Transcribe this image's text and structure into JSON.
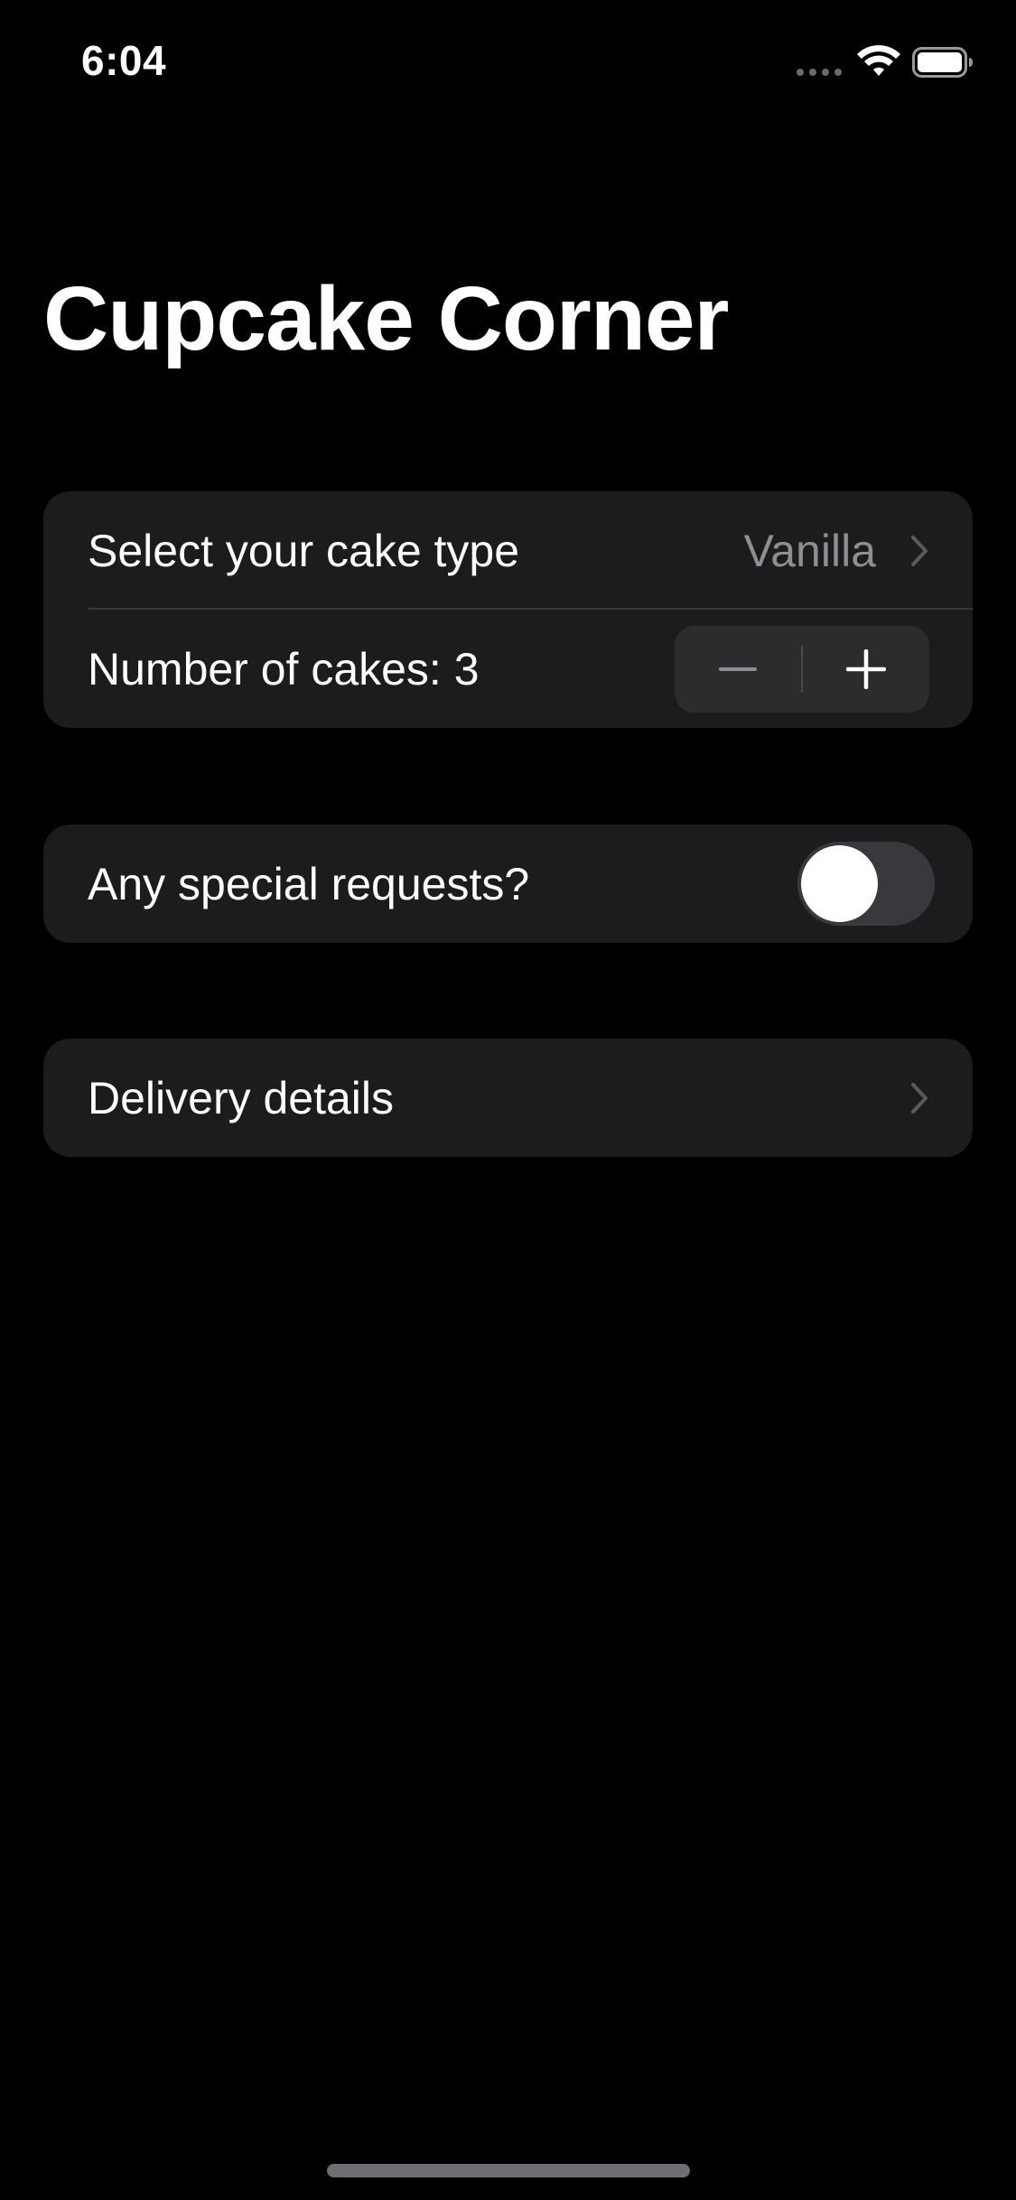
{
  "status_bar": {
    "time": "6:04",
    "icons": [
      "cellular-signal-icon",
      "wifi-icon",
      "battery-icon"
    ]
  },
  "title": "Cupcake Corner",
  "sections": {
    "order": {
      "cake_type_label": "Select your cake type",
      "cake_type_value": "Vanilla",
      "quantity_label": "Number of cakes: 3",
      "quantity": 3
    },
    "special": {
      "label": "Any special requests?",
      "toggle_on": false
    },
    "delivery": {
      "label": "Delivery details"
    }
  },
  "colors": {
    "background": "#000000",
    "cell_background": "#1c1c1e",
    "secondary_text": "#8e8e93",
    "separator": "#38383a"
  }
}
